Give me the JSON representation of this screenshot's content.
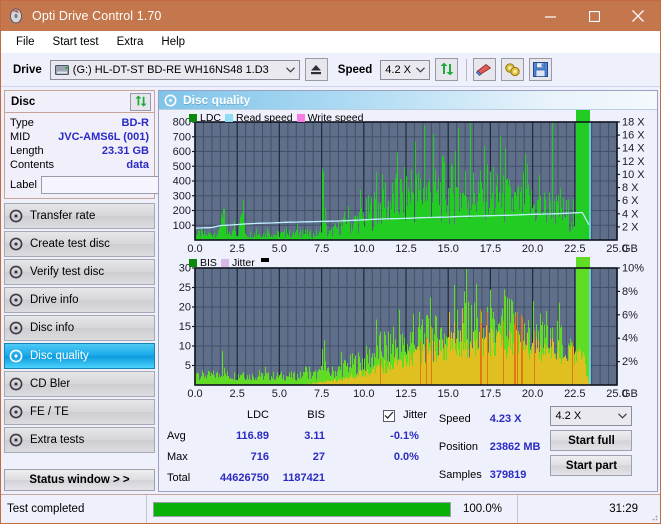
{
  "window": {
    "title": "Opti Drive Control 1.70",
    "app_icon": "disc-icon",
    "minimize": "minimize",
    "maximize": "maximize",
    "close": "close",
    "titlebar_color": "#c4764c"
  },
  "menu": {
    "items": [
      "File",
      "Start test",
      "Extra",
      "Help"
    ]
  },
  "toolbar": {
    "drive_label": "Drive",
    "drive_value": "(G:)   HL-DT-ST BD-RE  WH16NS48 1.D3",
    "speed_label": "Speed",
    "speed_value": "4.2 X",
    "buttons": [
      {
        "name": "refresh-drive-button",
        "icon": "refresh-icon"
      },
      {
        "name": "erase-button",
        "icon": "eraser-icon"
      },
      {
        "name": "settings-button",
        "icon": "gear-icon"
      },
      {
        "name": "save-button",
        "icon": "floppy-icon"
      }
    ]
  },
  "sidebar": {
    "disc_panel": {
      "title": "Disc",
      "refresh_icon": "refresh-icon",
      "rows": [
        {
          "key": "Type",
          "value": "BD-R"
        },
        {
          "key": "MID",
          "value": "JVC-AMS6L (001)"
        },
        {
          "key": "Length",
          "value": "23.31 GB"
        },
        {
          "key": "Contents",
          "value": "data"
        }
      ],
      "label_key": "Label",
      "label_value": "",
      "label_placeholder": "",
      "label_button_icon": "disc-icon"
    },
    "items": [
      {
        "label": "Transfer rate",
        "icon": "disc-icon",
        "active": false
      },
      {
        "label": "Create test disc",
        "icon": "disc-icon",
        "active": false
      },
      {
        "label": "Verify test disc",
        "icon": "disc-icon",
        "active": false
      },
      {
        "label": "Drive info",
        "icon": "disc-icon",
        "active": false
      },
      {
        "label": "Disc info",
        "icon": "disc-icon",
        "active": false
      },
      {
        "label": "Disc quality",
        "icon": "disc-icon",
        "active": true
      },
      {
        "label": "CD Bler",
        "icon": "disc-icon",
        "active": false
      },
      {
        "label": "FE / TE",
        "icon": "disc-icon",
        "active": false
      },
      {
        "label": "Extra tests",
        "icon": "disc-icon",
        "active": false
      }
    ],
    "status_window_button": "Status window > >"
  },
  "main": {
    "pane_title": "Disc quality",
    "pane_icon": "disc-icon"
  },
  "stats": {
    "col_headers": [
      "",
      "LDC",
      "BIS"
    ],
    "rows": [
      {
        "label": "Avg",
        "ldc": "116.89",
        "bis": "3.11",
        "jitter": "-0.1%"
      },
      {
        "label": "Max",
        "ldc": "716",
        "bis": "27",
        "jitter": "0.0%"
      },
      {
        "label": "Total",
        "ldc": "44626750",
        "bis": "1187421",
        "jitter": ""
      }
    ],
    "jitter_label": "Jitter",
    "jitter_checked": true,
    "speed_label": "Speed",
    "speed_value": "4.23 X",
    "position_label": "Position",
    "position_value": "23862 MB",
    "samples_label": "Samples",
    "samples_value": "379819",
    "speed_select": "4.2 X",
    "start_full_button": "Start full",
    "start_part_button": "Start part"
  },
  "statusbar": {
    "message": "Test completed",
    "progress_percent": "100.0%",
    "progress_value": 100,
    "elapsed": "31:29"
  },
  "chart_data": [
    {
      "type": "area",
      "id": "ldc-chart",
      "title": "LDC / Read speed",
      "xlabel": "GB",
      "ylabel": "LDC",
      "xlim": [
        0,
        25
      ],
      "ylim": [
        0,
        800
      ],
      "xticks": [
        "0.0",
        "2.5",
        "5.0",
        "7.5",
        "10.0",
        "12.5",
        "15.0",
        "17.5",
        "20.0",
        "22.5",
        "25.0"
      ],
      "yticks": [
        100,
        200,
        300,
        400,
        500,
        600,
        700,
        800
      ],
      "y2ticks": [
        "2 X",
        "4 X",
        "6 X",
        "8 X",
        "10 X",
        "12 X",
        "14 X",
        "16 X",
        "18 X"
      ],
      "y2lim": [
        0,
        18
      ],
      "grid": true,
      "legend": [
        {
          "label": "LDC",
          "color": "#0a8a0a"
        },
        {
          "label": "Read speed",
          "color": "#8fdcf5"
        },
        {
          "label": "Write speed",
          "color": "#f57ce0"
        }
      ],
      "series": [
        {
          "name": "LDC",
          "color": "#22cc22",
          "x": [
            0.0,
            0.2,
            0.4,
            0.6,
            0.8,
            1.0,
            1.2,
            1.4,
            1.6,
            1.8,
            2.0,
            2.2,
            2.4,
            2.6,
            2.8,
            3.0,
            3.2,
            3.4,
            3.6,
            3.8,
            4.0,
            4.2,
            4.4,
            4.6,
            4.8,
            5.0,
            5.2,
            5.4,
            5.6,
            5.8,
            6.0,
            6.2,
            6.4,
            6.6,
            6.8,
            7.0,
            7.2,
            7.4,
            7.6,
            7.8,
            8.0,
            8.2,
            8.4,
            8.6,
            8.8,
            9.0,
            9.2,
            9.4,
            9.6,
            9.8,
            10.0,
            10.2,
            10.4,
            10.6,
            10.8,
            11.0,
            11.2,
            11.4,
            11.6,
            11.8,
            12.0,
            12.2,
            12.4,
            12.6,
            12.8,
            13.0,
            13.2,
            13.4,
            13.6,
            13.8,
            14.0,
            14.2,
            14.4,
            14.6,
            14.8,
            15.0,
            15.2,
            15.4,
            15.6,
            15.8,
            16.0,
            16.2,
            16.4,
            16.6,
            16.8,
            17.0,
            17.2,
            17.4,
            17.6,
            17.8,
            18.0,
            18.2,
            18.4,
            18.6,
            18.8,
            19.0,
            19.2,
            19.4,
            19.6,
            19.8,
            20.0,
            20.2,
            20.4,
            20.6,
            20.8,
            21.0,
            21.2,
            21.4,
            21.6,
            21.8,
            22.0,
            22.2,
            22.4,
            22.6,
            22.8,
            23.0,
            23.2,
            23.4
          ],
          "y": [
            60,
            70,
            80,
            55,
            65,
            75,
            90,
            60,
            440,
            70,
            60,
            80,
            100,
            75,
            380,
            70,
            65,
            80,
            60,
            75,
            70,
            60,
            85,
            70,
            60,
            75,
            65,
            80,
            70,
            60,
            90,
            70,
            65,
            80,
            70,
            60,
            75,
            65,
            545,
            70,
            80,
            110,
            130,
            150,
            170,
            300,
            180,
            200,
            220,
            250,
            270,
            300,
            330,
            350,
            370,
            390,
            520,
            400,
            420,
            450,
            470,
            490,
            500,
            480,
            620,
            500,
            520,
            540,
            510,
            530,
            560,
            500,
            520,
            560,
            600,
            510,
            530,
            550,
            500,
            520,
            560,
            540,
            500,
            520,
            540,
            500,
            680,
            520,
            500,
            480,
            470,
            450,
            460,
            440,
            430,
            420,
            410,
            400,
            600,
            400,
            390,
            380,
            370,
            360,
            350,
            340,
            610,
            330,
            320,
            310,
            300,
            290,
            280,
            170
          ]
        },
        {
          "name": "Read speed",
          "color": "#bff0ff",
          "x": [
            0.0,
            1.0,
            1.5,
            2.2,
            3.0,
            3.8,
            4.6,
            5.4,
            6.2,
            7.0,
            7.8,
            8.6,
            9.4,
            10.2,
            11.0,
            11.8,
            12.6,
            13.4,
            14.2,
            15.0,
            15.8,
            16.6,
            17.4,
            18.2,
            19.0,
            19.8,
            20.6,
            21.4,
            22.2,
            23.0,
            23.4
          ],
          "y_speed": [
            1.8,
            1.9,
            2.2,
            2.3,
            2.45,
            2.55,
            2.6,
            2.7,
            2.75,
            2.8,
            2.85,
            2.9,
            3.0,
            3.1,
            3.2,
            3.25,
            3.3,
            3.4,
            3.45,
            3.5,
            3.6,
            3.65,
            3.7,
            3.75,
            3.8,
            3.9,
            3.95,
            4.0,
            4.1,
            4.2,
            2.3
          ]
        }
      ],
      "marker_line": {
        "x": 23.4,
        "color": "#6fd8f5"
      }
    },
    {
      "type": "area",
      "id": "bis-chart",
      "title": "BIS / Jitter",
      "xlabel": "GB",
      "ylabel": "BIS",
      "xlim": [
        0,
        25
      ],
      "ylim": [
        0,
        30
      ],
      "xticks": [
        "0.0",
        "2.5",
        "5.0",
        "7.5",
        "10.0",
        "12.5",
        "15.0",
        "17.5",
        "20.0",
        "22.5",
        "25.0"
      ],
      "yticks": [
        5,
        10,
        15,
        20,
        25,
        30
      ],
      "y2ticks": [
        "2%",
        "4%",
        "6%",
        "8%",
        "10%"
      ],
      "y2lim": [
        0,
        10
      ],
      "grid": true,
      "legend": [
        {
          "label": "BIS",
          "color": "#0a8a0a"
        },
        {
          "label": "Jitter",
          "color": "#d9b8e8"
        }
      ],
      "series": [
        {
          "name": "BIS",
          "color": "#5fdc23",
          "x": [
            0.0,
            0.2,
            0.4,
            0.6,
            0.8,
            1.0,
            1.2,
            1.4,
            1.6,
            1.8,
            2.0,
            2.2,
            2.4,
            2.6,
            2.8,
            3.0,
            3.2,
            3.4,
            3.6,
            3.8,
            4.0,
            4.2,
            4.4,
            4.6,
            4.8,
            5.0,
            5.2,
            5.4,
            5.6,
            5.8,
            6.0,
            6.2,
            6.4,
            6.6,
            6.8,
            7.0,
            7.2,
            7.4,
            7.6,
            7.8,
            8.0,
            8.2,
            8.4,
            8.6,
            8.8,
            9.0,
            9.2,
            9.4,
            9.6,
            9.8,
            10.0,
            10.2,
            10.4,
            10.6,
            10.8,
            11.0,
            11.2,
            11.4,
            11.6,
            11.8,
            12.0,
            12.2,
            12.4,
            12.6,
            12.8,
            13.0,
            13.2,
            13.4,
            13.6,
            13.8,
            14.0,
            14.2,
            14.4,
            14.6,
            14.8,
            15.0,
            15.2,
            15.4,
            15.6,
            15.8,
            16.0,
            16.2,
            16.4,
            16.6,
            16.8,
            17.0,
            17.2,
            17.4,
            17.6,
            17.8,
            18.0,
            18.2,
            18.4,
            18.6,
            18.8,
            19.0,
            19.2,
            19.4,
            19.6,
            19.8,
            20.0,
            20.2,
            20.4,
            20.6,
            20.8,
            21.0,
            21.2,
            21.4,
            21.6,
            21.8,
            22.0,
            22.2,
            22.4,
            22.6,
            22.8,
            23.0,
            23.2,
            23.4
          ],
          "y": [
            8.5,
            4.2,
            3.8,
            4.0,
            3.6,
            3.8,
            4.0,
            3.8,
            6.8,
            4.0,
            3.6,
            3.8,
            3.6,
            3.8,
            5.5,
            3.6,
            3.4,
            3.6,
            3.4,
            3.6,
            3.4,
            3.6,
            3.4,
            3.6,
            3.4,
            3.6,
            3.4,
            3.6,
            3.4,
            3.6,
            3.4,
            3.6,
            3.8,
            4.0,
            3.8,
            4.0,
            4.2,
            4.4,
            12.2,
            4.6,
            4.8,
            5.2,
            5.6,
            6.0,
            7.0,
            7.5,
            8.0,
            8.5,
            8.8,
            9.2,
            9.6,
            10.5,
            11.0,
            12.0,
            13.5,
            14.0,
            16.0,
            13.5,
            14.5,
            14.0,
            15.0,
            14.5,
            15.0,
            14.5,
            19.0,
            16.0,
            17.0,
            22.0,
            17.5,
            18.5,
            21.0,
            18.0,
            19.0,
            20.0,
            19.5,
            18.5,
            20.5,
            22.0,
            21.0,
            20.0,
            26.8,
            21.5,
            22.5,
            23.0,
            21.0,
            19.5,
            20.0,
            21.0,
            19.5,
            20.0,
            19.5,
            20.5,
            25.2,
            22.0,
            24.2,
            21.0,
            20.0,
            19.0,
            18.5,
            18.0,
            17.5,
            17.0,
            22.0,
            17.0,
            16.5,
            16.0,
            15.5,
            16.0,
            22.0,
            15.0,
            14.5,
            14.0,
            13.0,
            10.0
          ]
        },
        {
          "name": "Jitter",
          "color": "#e0c020",
          "x": [
            0.0,
            2.0,
            4.0,
            6.0,
            8.0,
            9.0,
            10.0,
            11.0,
            12.0,
            13.0,
            14.0,
            15.0,
            16.0,
            17.0,
            18.0,
            19.0,
            20.0,
            21.0,
            22.0,
            23.0,
            23.4
          ],
          "y_pct": [
            0.0,
            0.0,
            0.0,
            0.0,
            0.4,
            0.9,
            1.4,
            2.0,
            2.6,
            3.2,
            4.2,
            4.6,
            5.0,
            5.2,
            5.0,
            4.8,
            4.4,
            4.2,
            3.8,
            3.5,
            0.0
          ]
        }
      ],
      "marker_line": {
        "x": 23.4,
        "color": "#6fd8f5"
      }
    }
  ]
}
